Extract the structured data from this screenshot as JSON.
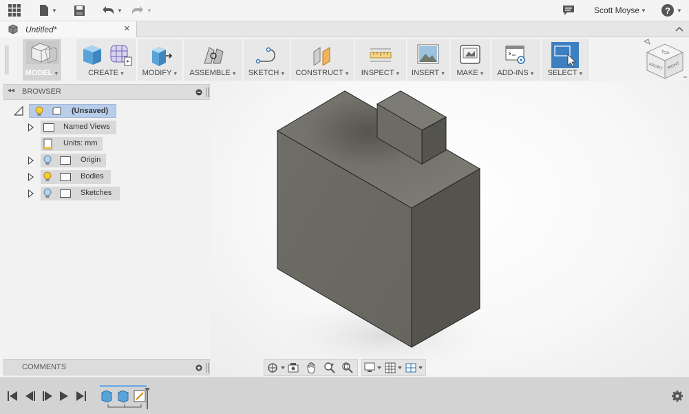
{
  "topbar": {
    "user_name": "Scott Moyse",
    "icons": [
      "app-grid-icon",
      "file-icon",
      "save-icon",
      "undo-icon",
      "redo-icon",
      "comment-icon",
      "help-icon"
    ]
  },
  "tab": {
    "title": "Untitled*",
    "close_glyph": "×"
  },
  "ribbon": {
    "groups": [
      {
        "label": "MODEL",
        "icon": "model-workspace-icon"
      },
      {
        "label": "CREATE",
        "icon": "box-icon"
      },
      {
        "label": "MODIFY",
        "icon": "press-pull-icon"
      },
      {
        "label": "ASSEMBLE",
        "icon": "joint-icon"
      },
      {
        "label": "SKETCH",
        "icon": "sketch-line-icon"
      },
      {
        "label": "CONSTRUCT",
        "icon": "plane-icon"
      },
      {
        "label": "INSPECT",
        "icon": "measure-icon"
      },
      {
        "label": "INSERT",
        "icon": "image-icon"
      },
      {
        "label": "MAKE",
        "icon": "printer-icon"
      },
      {
        "label": "ADD-INS",
        "icon": "scripts-icon"
      },
      {
        "label": "SELECT",
        "icon": "select-cursor-icon"
      }
    ]
  },
  "browser": {
    "title": "BROWSER",
    "root": "(Unsaved)",
    "items": [
      {
        "label": "Named Views"
      },
      {
        "label": "Units: mm"
      },
      {
        "label": "Origin"
      },
      {
        "label": "Bodies"
      },
      {
        "label": "Sketches"
      }
    ]
  },
  "comments": {
    "title": "COMMENTS"
  },
  "colors": {
    "accent": "#3d7fc1",
    "body_front": "#6b6a63",
    "body_side": "#55534d",
    "body_top": "#7c7b74"
  }
}
